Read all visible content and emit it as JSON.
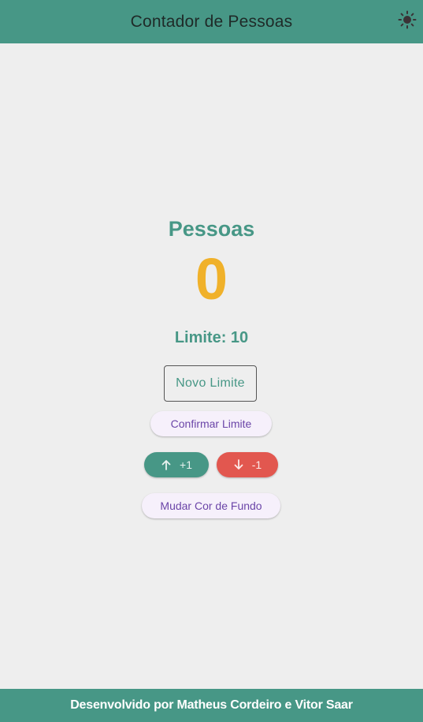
{
  "appbar": {
    "title": "Contador de Pessoas",
    "theme_icon": "sun-icon"
  },
  "main": {
    "label": "Pessoas",
    "count": "0",
    "limit_text": "Limite: 10",
    "limit_input": {
      "placeholder": "Novo Limite",
      "value": ""
    },
    "confirm_label": "Confirmar Limite",
    "increment": {
      "icon": "arrow-up-icon",
      "label": "+1"
    },
    "decrement": {
      "icon": "arrow-down-icon",
      "label": "-1"
    },
    "background_label": "Mudar Cor de Fundo"
  },
  "footer": {
    "text": "Desenvolvido por Matheus Cordeiro e Vitor Saar"
  },
  "colors": {
    "primary": "#479786",
    "counter": "#f0b12a",
    "decrement": "#e2574f",
    "button_text": "#6b45a8",
    "background": "#eeeeee"
  }
}
